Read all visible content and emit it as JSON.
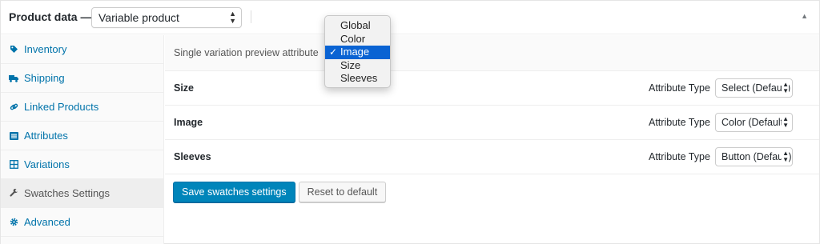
{
  "header": {
    "title": "Product data —",
    "product_type": "Variable product",
    "collapse_icon": "triangle-up-icon"
  },
  "sidebar": {
    "items": [
      {
        "label": "Inventory",
        "icon": "tag-icon"
      },
      {
        "label": "Shipping",
        "icon": "truck-icon"
      },
      {
        "label": "Linked Products",
        "icon": "link-icon"
      },
      {
        "label": "Attributes",
        "icon": "list-icon"
      },
      {
        "label": "Variations",
        "icon": "grid-icon"
      },
      {
        "label": "Swatches Settings",
        "icon": "wrench-icon",
        "active": true
      },
      {
        "label": "Advanced",
        "icon": "gear-icon"
      }
    ]
  },
  "main": {
    "preview_label": "Single variation preview attribute",
    "attribute_type_label": "Attribute Type",
    "attributes": [
      {
        "name": "Size",
        "type": "Select (Default)"
      },
      {
        "name": "Image",
        "type": "Color (Default)"
      },
      {
        "name": "Sleeves",
        "type": "Button (Default)"
      }
    ],
    "save_button": "Save swatches settings",
    "reset_button": "Reset to default"
  },
  "dropdown": {
    "options": [
      "Global",
      "Color",
      "Image",
      "Size",
      "Sleeves"
    ],
    "selected": "Image"
  },
  "colors": {
    "link": "#0073aa",
    "primary_button": "#0085ba",
    "dropdown_highlight": "#0a63d3"
  }
}
